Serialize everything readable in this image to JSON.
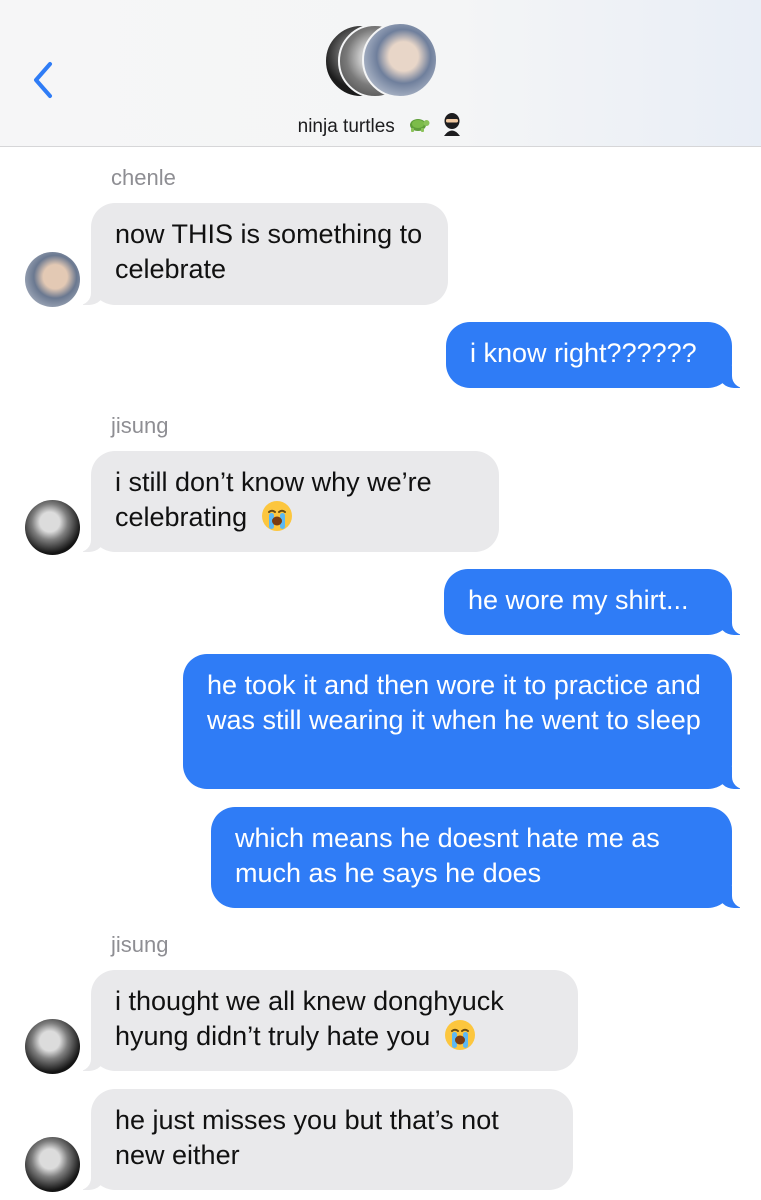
{
  "header": {
    "group_name": "ninja turtles",
    "group_emoji": [
      "turtle-emoji",
      "ninja-emoji"
    ]
  },
  "messages": [
    {
      "sender": "chenle",
      "text": "now THIS is something to celebrate",
      "direction": "incoming"
    },
    {
      "text": "i know right??????",
      "direction": "outgoing"
    },
    {
      "sender": "jisung",
      "text": "i still don’t know why we’re celebrating",
      "emoji": "loudly-crying-face",
      "direction": "incoming"
    },
    {
      "text": "he wore my shirt...",
      "direction": "outgoing"
    },
    {
      "text": "he took it and then wore it to practice and was still wearing it when he went to sleep",
      "direction": "outgoing"
    },
    {
      "text": "which means he doesnt hate me as much as he says he does",
      "direction": "outgoing"
    },
    {
      "sender": "jisung",
      "text": "i thought we all knew donghyuck hyung didn’t truly hate you",
      "emoji": "loudly-crying-face",
      "direction": "incoming"
    },
    {
      "text": "he just misses you but that’s not new either",
      "direction": "incoming"
    }
  ],
  "colors": {
    "outgoing_bubble": "#2f7cf6",
    "incoming_bubble": "#e9e9eb",
    "back_chevron": "#2f7cf6",
    "sender_label": "#8e8e93"
  }
}
